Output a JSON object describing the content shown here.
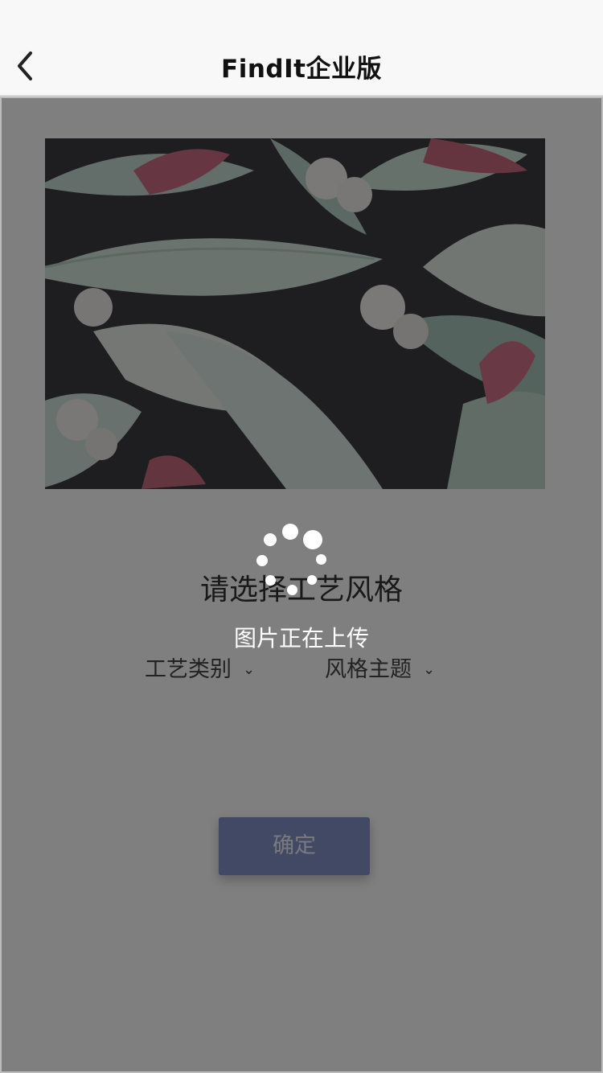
{
  "nav": {
    "title": "FindIt企业版",
    "back_icon": "chevron-left-icon"
  },
  "photo": {
    "subject": "tropical-leaf-print"
  },
  "craft": {
    "heading": "请选择工艺风格",
    "category_label": "工艺类别",
    "theme_label": "风格主题",
    "chevron": "⌄"
  },
  "confirm": {
    "label": "确定"
  },
  "loading": {
    "message": "图片正在上传",
    "icon": "spinner-icon"
  },
  "colors": {
    "confirm_button": "#8593c8",
    "overlay": "rgba(0,0,0,0.5)",
    "navbar": "#f8f8f8"
  }
}
